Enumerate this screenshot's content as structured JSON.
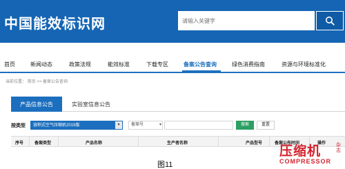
{
  "header": {
    "logo": "中国能效标识网",
    "search_placeholder": "请输入关键字"
  },
  "nav": {
    "items": [
      "首页",
      "新闻动态",
      "政策法规",
      "能效标准",
      "下载专区",
      "备案公告查询",
      "绿色消费指南",
      "资源与环境标准化"
    ],
    "active_index": 5
  },
  "breadcrumb": "当前位置： 首页 >> 备案公告查询",
  "tabs": {
    "active": "产品信息公告",
    "other": "实验室信息公告"
  },
  "filter": {
    "type_label": "按类型",
    "type_value": "容积式空气压缩机2019版",
    "field_value": "备案号",
    "search_label": "搜索",
    "reset_label": "重置"
  },
  "table": {
    "headers": [
      "序号",
      "备案类型",
      "产品名称",
      "生产者名称",
      "产品型号",
      "备案公布时间",
      "操作"
    ]
  },
  "caption": "图11",
  "watermark": {
    "main": "压缩机",
    "side": "杂志",
    "sub": "COMPRESSOR"
  },
  "colors": {
    "header_blue": "#1565b4",
    "accent_blue": "#1c6fbe",
    "search_green": "#2c9f63",
    "watermark_red": "#d4232e"
  }
}
